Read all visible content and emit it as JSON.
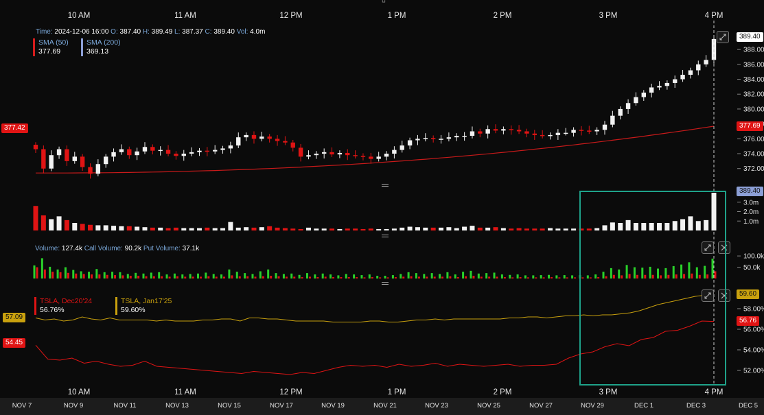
{
  "header": {
    "time_label": "Time:",
    "time_value": "2024-12-06 16:00",
    "o_label": "O:",
    "o_value": "387.40",
    "h_label": "H:",
    "h_value": "389.49",
    "l_label": "L:",
    "l_value": "387.37",
    "c_label": "C:",
    "c_value": "389.40",
    "vol_label": "Vol:",
    "vol_value": "4.0m"
  },
  "sma": {
    "sma50_label": "SMA (50)",
    "sma50_value": "377.69",
    "sma200_label": "SMA (200)",
    "sma200_value": "369.13",
    "sma50_color": "#d61c1c",
    "sma200_color": "#8c9fd6"
  },
  "volume_header": {
    "volume_label": "Volume:",
    "volume_value": "127.4k",
    "call_label": "Call Volume:",
    "call_value": "90.2k",
    "put_label": "Put Volume:",
    "put_value": "37.1k"
  },
  "iv_legend": {
    "series1_label": "TSLA, Dec20'24",
    "series1_value": "56.76%",
    "series2_label": "TSLA, Jan17'25",
    "series2_value": "59.60%",
    "series1_color": "#e01414",
    "series2_color": "#c9a10e"
  },
  "tags": {
    "price_left": "377.42",
    "price_right_last": "389.40",
    "sma_right": "377.69",
    "vol_right": "389.40",
    "iv_left_gold": "57.09",
    "iv_left_red": "54.45",
    "iv_right_gold": "59.60",
    "iv_right_red": "56.76"
  },
  "top_time_labels": [
    "10 AM",
    "11 AM",
    "12 PM",
    "1 PM",
    "2 PM",
    "3 PM",
    "4 PM"
  ],
  "bottom_time_labels": [
    "10 AM",
    "11 AM",
    "12 PM",
    "1 PM",
    "2 PM",
    "3 PM",
    "4 PM"
  ],
  "date_labels": [
    "NOV 7",
    "NOV 9",
    "NOV 11",
    "NOV 13",
    "NOV 15",
    "NOV 17",
    "NOV 19",
    "NOV 21",
    "NOV 23",
    "NOV 25",
    "NOV 27",
    "NOV 29",
    "DEC 1",
    "DEC 3",
    "DEC 5"
  ],
  "price_axis_ticks": [
    "388.00",
    "386.00",
    "384.00",
    "382.00",
    "380.00",
    "378.00",
    "376.00",
    "374.00",
    "372.00"
  ],
  "volume_axis_ticks": [
    "4.0m",
    "3.0m",
    "2.0m",
    "1.0m"
  ],
  "option_volume_axis_ticks": [
    "100.0k",
    "50.0k"
  ],
  "iv_axis_ticks": [
    "58.00%",
    "56.00%",
    "54.00%",
    "52.00%"
  ],
  "colors": {
    "up": "#f2f2f2",
    "down": "#e01414",
    "call": "#2ad12a",
    "put": "#e01414",
    "highlight": "#1fa28a",
    "background": "#0b0b0b"
  },
  "chart_data": [
    {
      "type": "candlestick",
      "title": "",
      "x_unit": "5-minute bars, 09:30–16:00",
      "ylim": [
        370.5,
        390.5
      ],
      "y_ticks": [
        372,
        374,
        376,
        378,
        380,
        382,
        384,
        386,
        388
      ],
      "closes": [
        374.6,
        372.0,
        373.8,
        374.6,
        373.0,
        373.6,
        372.2,
        371.3,
        372.6,
        373.6,
        374.2,
        374.6,
        373.8,
        374.3,
        374.9,
        374.4,
        374.5,
        374.0,
        373.7,
        374.0,
        374.2,
        374.4,
        374.3,
        374.5,
        374.7,
        375.1,
        376.2,
        376.5,
        376.0,
        376.3,
        376.0,
        375.7,
        375.5,
        374.8,
        373.6,
        373.8,
        374.0,
        374.2,
        373.9,
        374.1,
        373.8,
        373.7,
        373.6,
        373.3,
        373.6,
        374.0,
        374.5,
        375.1,
        375.8,
        376.0,
        376.1,
        376.0,
        376.0,
        376.2,
        376.4,
        376.4,
        377.0,
        376.7,
        377.3,
        377.1,
        377.3,
        377.2,
        377.0,
        376.7,
        376.5,
        376.4,
        376.5,
        376.8,
        376.8,
        377.2,
        377.1,
        377.0,
        377.2,
        377.9,
        379.1,
        380.0,
        380.8,
        381.6,
        382.2,
        382.9,
        383.1,
        383.5,
        384.0,
        384.6,
        385.2,
        386.0,
        386.6,
        389.4
      ],
      "sma_series": [
        {
          "name": "SMA (50)",
          "start": 371.4,
          "end": 377.69
        },
        {
          "name": "SMA (200)",
          "last": 369.13
        }
      ]
    },
    {
      "type": "bar",
      "title": "",
      "ylabel": "Volume",
      "ylim": [
        0,
        4.0
      ],
      "y_ticks": [
        "4.0m",
        "3.0m",
        "2.0m",
        "1.0m"
      ],
      "values_m": [
        2.6,
        1.6,
        1.2,
        1.5,
        1.1,
        0.8,
        0.7,
        0.6,
        0.55,
        0.55,
        0.5,
        0.45,
        0.45,
        0.4,
        0.35,
        0.3,
        0.3,
        0.25,
        0.3,
        0.25,
        0.25,
        0.25,
        0.3,
        0.25,
        0.25,
        0.9,
        0.3,
        0.35,
        0.3,
        0.35,
        0.45,
        0.3,
        0.25,
        0.2,
        0.15,
        0.3,
        0.2,
        0.2,
        0.2,
        0.15,
        0.2,
        0.2,
        0.15,
        0.2,
        0.15,
        0.15,
        0.2,
        0.3,
        0.4,
        0.35,
        0.3,
        0.3,
        0.3,
        0.35,
        0.25,
        0.4,
        0.5,
        0.3,
        0.3,
        0.35,
        0.25,
        0.2,
        0.25,
        0.2,
        0.2,
        0.2,
        0.25,
        0.2,
        0.2,
        0.2,
        0.2,
        0.2,
        0.25,
        0.55,
        0.85,
        0.8,
        1.1,
        0.8,
        0.8,
        0.8,
        0.8,
        0.8,
        1.0,
        1.2,
        1.5,
        1.0,
        1.1,
        4.0
      ],
      "last_label": "4.0m"
    },
    {
      "type": "bar",
      "title": "",
      "ylabel": "Option volume",
      "ylim": [
        0,
        140
      ],
      "y_ticks": [
        "100.0k",
        "50.0k"
      ],
      "series": [
        {
          "name": "Call Volume",
          "values_k": [
            58,
            90,
            52,
            40,
            50,
            38,
            32,
            30,
            42,
            28,
            30,
            28,
            20,
            25,
            22,
            26,
            28,
            18,
            22,
            18,
            20,
            22,
            26,
            20,
            18,
            40,
            30,
            24,
            20,
            32,
            40,
            24,
            20,
            22,
            16,
            24,
            18,
            22,
            18,
            14,
            20,
            18,
            15,
            18,
            12,
            12,
            15,
            20,
            28,
            24,
            20,
            24,
            20,
            28,
            18,
            30,
            34,
            22,
            24,
            26,
            18,
            16,
            18,
            14,
            14,
            15,
            16,
            14,
            15,
            14,
            15,
            14,
            18,
            30,
            46,
            40,
            60,
            50,
            48,
            52,
            44,
            46,
            55,
            62,
            72,
            50,
            56,
            88
          ]
        },
        {
          "name": "Put Volume",
          "values_k": [
            50,
            40,
            30,
            28,
            25,
            22,
            20,
            18,
            18,
            16,
            15,
            14,
            12,
            12,
            10,
            10,
            10,
            8,
            10,
            8,
            8,
            8,
            10,
            8,
            8,
            14,
            10,
            10,
            8,
            10,
            12,
            10,
            8,
            8,
            6,
            8,
            6,
            8,
            6,
            6,
            6,
            6,
            5,
            6,
            5,
            5,
            6,
            8,
            10,
            8,
            8,
            8,
            8,
            10,
            6,
            10,
            12,
            8,
            8,
            8,
            6,
            5,
            6,
            5,
            5,
            5,
            6,
            5,
            5,
            5,
            5,
            5,
            6,
            10,
            16,
            14,
            20,
            16,
            16,
            16,
            14,
            16,
            18,
            20,
            22,
            16,
            18,
            32
          ]
        }
      ],
      "last_total": "127.4k"
    },
    {
      "type": "line",
      "title": "",
      "ylabel": "Implied volatility",
      "ylim": [
        51.0,
        60.0
      ],
      "y_ticks": [
        "58.00%",
        "56.00%",
        "54.00%",
        "52.00%"
      ],
      "series": [
        {
          "name": "TSLA, Jan17'25",
          "values": [
            57.1,
            56.9,
            57.0,
            56.8,
            56.9,
            57.2,
            57.0,
            56.9,
            57.1,
            56.9,
            56.9,
            56.9,
            56.9,
            56.8,
            56.9,
            56.8,
            56.8,
            56.8,
            56.9,
            56.9,
            57.0,
            57.0,
            56.8,
            57.1,
            57.1,
            57.0,
            57.0,
            56.9,
            56.8,
            56.8,
            56.8,
            56.8,
            56.7,
            56.7,
            56.7,
            56.7,
            56.8,
            56.8,
            56.7,
            56.7,
            56.8,
            56.9,
            56.9,
            57.0,
            56.9,
            57.0,
            57.0,
            57.0,
            57.0,
            57.0,
            57.0,
            57.1,
            57.1,
            57.2,
            57.2,
            57.1,
            57.2,
            57.3,
            57.3,
            57.4,
            57.3,
            57.4,
            57.4,
            57.5,
            57.6,
            57.8,
            58.1,
            58.4,
            58.6,
            58.8,
            59.0,
            59.2,
            59.3,
            59.6
          ]
        },
        {
          "name": "TSLA, Dec20'24",
          "values": [
            54.45,
            53.1,
            53.0,
            53.2,
            52.7,
            52.9,
            52.6,
            52.4,
            52.5,
            52.9,
            52.4,
            52.3,
            52.2,
            52.1,
            52.0,
            51.9,
            51.8,
            51.7,
            51.9,
            51.8,
            51.7,
            51.6,
            51.8,
            51.7,
            52.0,
            52.3,
            52.5,
            52.4,
            52.5,
            52.3,
            52.6,
            52.4,
            52.5,
            52.7,
            52.4,
            52.6,
            52.5,
            52.4,
            52.5,
            52.6,
            52.4,
            52.5,
            52.5,
            52.6,
            53.2,
            53.6,
            53.8,
            54.3,
            54.6,
            54.4,
            55.0,
            55.2,
            55.8,
            55.9,
            56.3,
            56.8,
            56.76
          ]
        }
      ]
    }
  ]
}
